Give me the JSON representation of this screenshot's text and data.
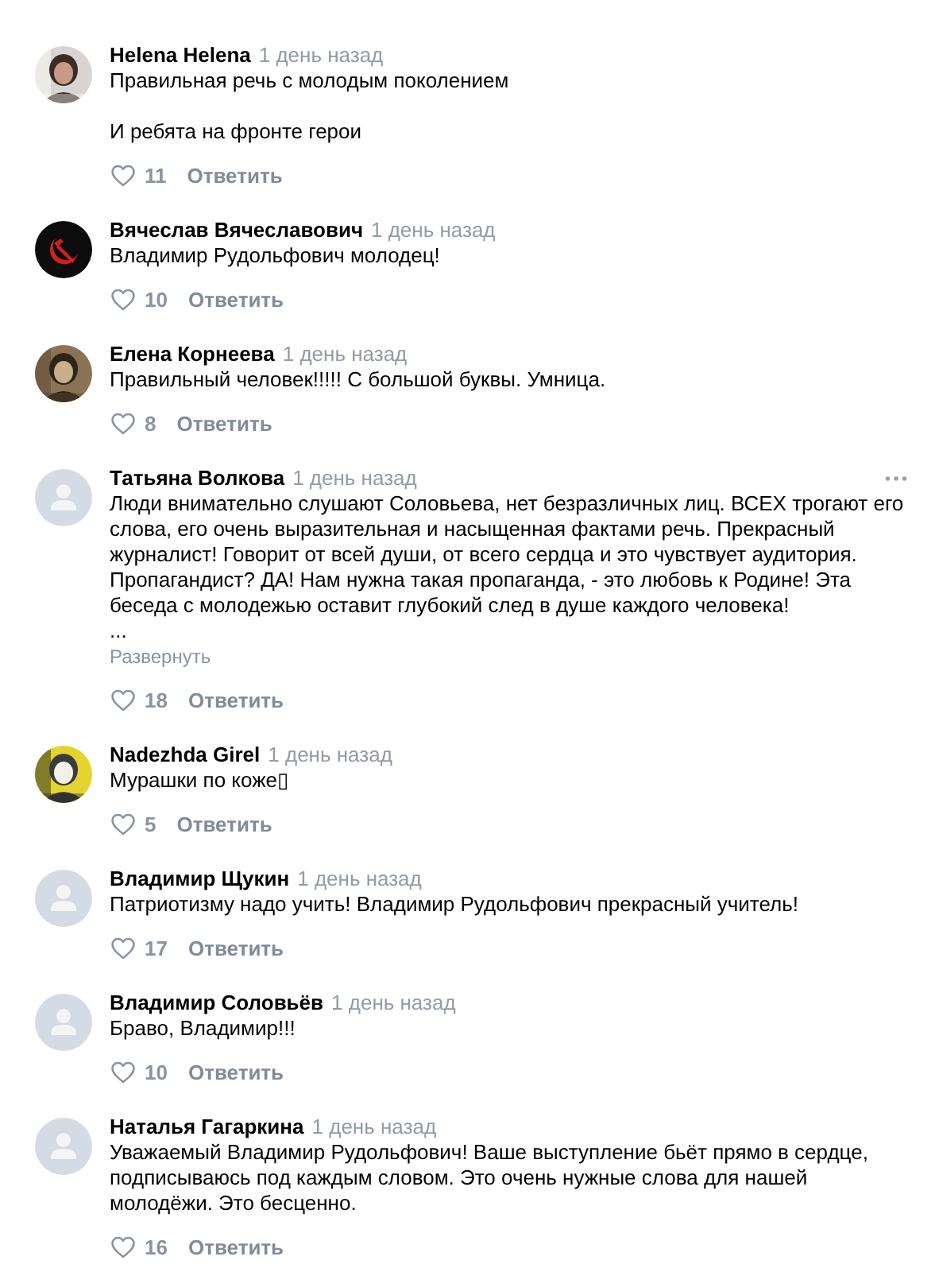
{
  "comments": [
    {
      "author": "Helena Helena",
      "time": "1 день назад",
      "avatar": {
        "kind": "picture"
      },
      "has_menu": false,
      "text": [
        "Правильная речь с молодым поколением",
        "И ребята на фронте герои"
      ],
      "likes": "11",
      "reply": "Ответить"
    },
    {
      "author": "Вячеслав Вячеславович",
      "time": "1 день назад",
      "avatar": {
        "kind": "emblem"
      },
      "has_menu": false,
      "text": [
        "Владимир Рудольфович молодец!"
      ],
      "likes": "10",
      "reply": "Ответить"
    },
    {
      "author": "Елена Корнеева",
      "time": "1 день назад",
      "avatar": {
        "kind": "picture"
      },
      "has_menu": false,
      "text": [
        "Правильный человек!!!!! С большой буквы. Умница."
      ],
      "likes": "8",
      "reply": "Ответить"
    },
    {
      "author": "Татьяна Волкова",
      "time": "1 день назад",
      "avatar": {
        "kind": "default"
      },
      "has_menu": true,
      "text": [
        "Люди внимательно слушают Соловьева, нет безразличных лиц. ВСЕХ трогают его слова, его очень выразительная и насыщенная фактами речь. Прекрасный журналист! Говорит от всей души, от всего сердца и это чувствует аудитория. Пропагандист? ДА! Нам нужна такая пропаганда, - это любовь к Родине! Эта беседа с молодежью оставит глубокий след в душе каждого человека!"
      ],
      "ellipsis": "...",
      "expand": "Развернуть",
      "likes": "18",
      "reply": "Ответить"
    },
    {
      "author": "Nadezhda Girel",
      "time": "1 день назад",
      "avatar": {
        "kind": "picture"
      },
      "has_menu": false,
      "text": [
        "Мурашки по коже▯"
      ],
      "likes": "5",
      "reply": "Ответить"
    },
    {
      "author": "Владимир Щукин",
      "time": "1 день назад",
      "avatar": {
        "kind": "default"
      },
      "has_menu": false,
      "text": [
        "Патриотизму надо учить! Владимир Рудольфович прекрасный учитель!"
      ],
      "likes": "17",
      "reply": "Ответить"
    },
    {
      "author": "Владимир Соловьёв",
      "time": "1 день назад",
      "avatar": {
        "kind": "default"
      },
      "has_menu": false,
      "text": [
        "Браво, Владимир!!!"
      ],
      "likes": "10",
      "reply": "Ответить"
    },
    {
      "author": "Наталья Гагаркина",
      "time": "1 день назад",
      "avatar": {
        "kind": "default"
      },
      "has_menu": false,
      "text": [
        "Уважаемый Владимир Рудольфович! Ваше выступление бьёт прямо в сердце, подписываюсь под каждым словом. Это очень нужные слова для нашей молодёжи. Это бесценно."
      ],
      "likes": "16",
      "reply": "Ответить"
    }
  ]
}
